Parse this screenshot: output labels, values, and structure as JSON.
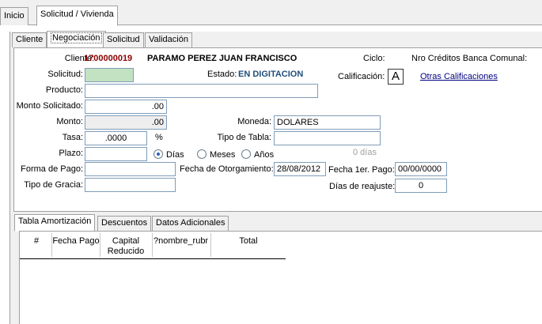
{
  "top_tabs": [
    {
      "label": "Inicio",
      "active": false
    },
    {
      "label": "Solicitud  / Vivienda",
      "active": true
    }
  ],
  "sub_tabs": [
    {
      "label": "Cliente",
      "active": false
    },
    {
      "label": "Negociación",
      "active": true
    },
    {
      "label": "Solicitud",
      "active": false
    },
    {
      "label": "Validación",
      "active": false
    }
  ],
  "form": {
    "cliente_label": "Cliente:",
    "cliente_code": "1700000019",
    "cliente_name": "PARAMO PEREZ JUAN FRANCISCO",
    "ciclo_label": "Ciclo:",
    "nro_creditos_label": "Nro Créditos Banca Comunal:",
    "solicitud_label": "Solicitud:",
    "solicitud_value": "",
    "estado_label": "Estado:",
    "estado_value": "EN DIGITACION",
    "calificacion_label": "Calificación:",
    "calificacion_value": "A",
    "otras_calificaciones_link": "Otras Calificaciones",
    "producto_label": "Producto:",
    "producto_value": "",
    "monto_solicitado_label": "Monto Solicitado:",
    "monto_solicitado_value": ".00",
    "monto_label": "Monto:",
    "monto_value": ".00",
    "moneda_label": "Moneda:",
    "moneda_value": "DOLARES",
    "tasa_label": "Tasa:",
    "tasa_value": ".0000",
    "tasa_unit": "%",
    "tipo_tabla_label": "Tipo de Tabla:",
    "tipo_tabla_value": "",
    "plazo_label": "Plazo:",
    "plazo_value": "",
    "plazo_options": [
      "Días",
      "Meses",
      "Años"
    ],
    "plazo_selected": "Días",
    "plazo_dias_display": "0 días",
    "forma_pago_label": "Forma de Pago:",
    "forma_pago_value": "",
    "fecha_otorgamiento_label": "Fecha de Otorgamiento:",
    "fecha_otorgamiento_value": "28/08/2012",
    "fecha_primer_pago_label": "Fecha 1er. Pago:",
    "fecha_primer_pago_value": "00/00/0000",
    "tipo_gracia_label": "Tipo de Gracia:",
    "tipo_gracia_value": "",
    "dias_reajuste_label": "Días de reajuste:",
    "dias_reajuste_value": "0"
  },
  "bottom_tabs": [
    {
      "label": "Tabla Amortización",
      "active": true
    },
    {
      "label": "Descuentos",
      "active": false
    },
    {
      "label": "Datos Adicionales",
      "active": false
    }
  ],
  "grid": {
    "columns": [
      "#",
      "Fecha Pago",
      "Capital Reducido",
      "?nombre_rubr",
      "Total"
    ],
    "rows": []
  },
  "colors": {
    "window_bg": "#f0f0f0",
    "client_code": "#8b0000",
    "status": "#1f4e79",
    "link": "#000080",
    "solicitud_field": "#c2e2c2"
  }
}
